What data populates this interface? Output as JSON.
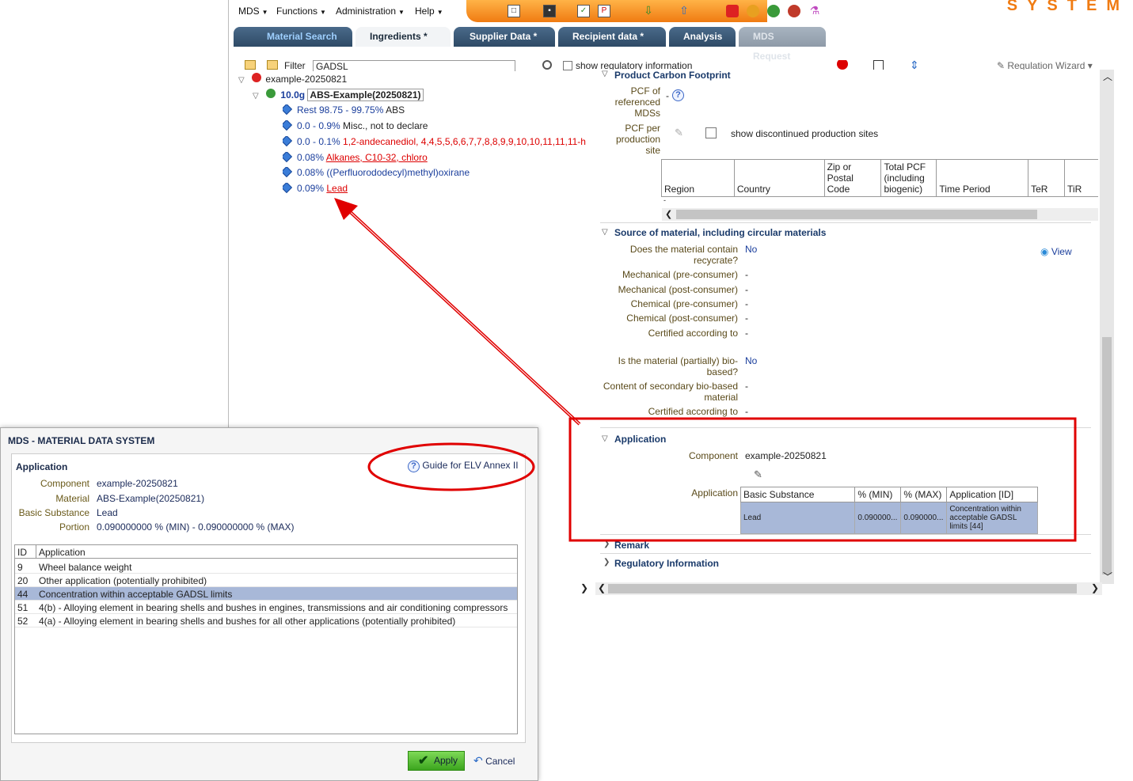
{
  "menu": {
    "items": [
      "MDS",
      "Functions",
      "Administration",
      "Help"
    ]
  },
  "brand": "SYSTEM",
  "tabs": [
    {
      "label": "Material Search"
    },
    {
      "label": "Ingredients *"
    },
    {
      "label": "Supplier Data *"
    },
    {
      "label": "Recipient data *"
    },
    {
      "label": "Analysis"
    },
    {
      "label": "MDS Request"
    }
  ],
  "filterbar": {
    "filter_label": "Filter",
    "filter_value": "GADSL",
    "show_reg_info": "show regulatory information",
    "reg_wizard": "Regulation Wizard"
  },
  "tree": {
    "root": "example-20250821",
    "component_weight": "10.0g",
    "component_name": "ABS-Example(20250821)",
    "items": [
      {
        "range": "Rest  98.75 - 99.75%",
        "name": "ABS",
        "style": "normal"
      },
      {
        "range": "0.0 - 0.9%",
        "name": "Misc., not to declare",
        "style": "normal"
      },
      {
        "range": "0.0 - 0.1%",
        "name": "1,2-andecanediol, 4,4,5,5,6,6,7,7,8,8,9,9,10,10,11,11,11-h",
        "style": "red"
      },
      {
        "range": "0.08%",
        "name": "Alkanes, C10-32, chloro",
        "style": "redlink"
      },
      {
        "range": "0.08%",
        "name": "((Perfluorododecyl)methyl)oxirane",
        "style": "blue"
      },
      {
        "range": "0.09%",
        "name": "Lead",
        "style": "redlink"
      }
    ]
  },
  "pcf": {
    "title": "Product Carbon Footprint",
    "ref_label": "PCF of referenced MDSs",
    "ref_value": "-",
    "site_label": "PCF per production site",
    "show_discontinued": "show discontinued production sites",
    "columns": [
      "Region",
      "Country",
      "Zip or Postal Code",
      "Total PCF (including biogenic)",
      "Time Period",
      "TeR",
      "TiR"
    ],
    "empty_row": "-"
  },
  "source": {
    "title": "Source of material, including circular materials",
    "view_label": "View",
    "rows": [
      {
        "label": "Does the material contain recycrate?",
        "value": "No"
      },
      {
        "label": "Mechanical (pre-consumer)",
        "value": "-"
      },
      {
        "label": "Mechanical (post-consumer)",
        "value": "-"
      },
      {
        "label": "Chemical (pre-consumer)",
        "value": "-"
      },
      {
        "label": "Chemical (post-consumer)",
        "value": "-"
      },
      {
        "label": "Certified according to",
        "value": "-"
      },
      {
        "label": "Is the material (partially) bio-based?",
        "value": "No"
      },
      {
        "label": "Content of secondary bio-based material",
        "value": "-"
      },
      {
        "label": "Certified according to",
        "value": "-"
      }
    ]
  },
  "application": {
    "title": "Application",
    "component_label": "Component",
    "component_value": "example-20250821",
    "application_label": "Application",
    "columns": [
      "Basic Substance",
      "% (MIN)",
      "% (MAX)",
      "Application [ID]"
    ],
    "row": [
      "Lead",
      "0.090000...",
      "0.090000...",
      "Concentration within acceptable GADSL limits [44]"
    ]
  },
  "remark": {
    "title": "Remark"
  },
  "regulatory": {
    "title": "Regulatory Information"
  },
  "dialog": {
    "title": "MDS - MATERIAL DATA SYSTEM",
    "section": "Application",
    "guide": "Guide for ELV Annex II",
    "fields": [
      {
        "label": "Component",
        "value": "example-20250821"
      },
      {
        "label": "Material",
        "value": "ABS-Example(20250821)"
      },
      {
        "label": "Basic Substance",
        "value": "Lead"
      },
      {
        "label": "Portion",
        "value": "0.090000000 % (MIN) - 0.090000000 % (MAX)"
      }
    ],
    "list_header": {
      "id": "ID",
      "text": "Application"
    },
    "list": [
      {
        "id": "9",
        "text": "Wheel balance weight"
      },
      {
        "id": "20",
        "text": "Other application (potentially prohibited)"
      },
      {
        "id": "44",
        "text": "Concentration within acceptable GADSL limits"
      },
      {
        "id": "51",
        "text": "4(b) - Alloying element in bearing shells and bushes in engines, transmissions and air conditioning compressors"
      },
      {
        "id": "52",
        "text": "4(a) - Alloying element in bearing shells and bushes for all other applications (potentially prohibited)"
      }
    ],
    "apply": "Apply",
    "cancel": "Cancel"
  },
  "colors": {
    "accent": "#f07b12",
    "tab": "#2e4a66",
    "annotation": "#e00000",
    "selected_row": "#a8b8d8"
  }
}
